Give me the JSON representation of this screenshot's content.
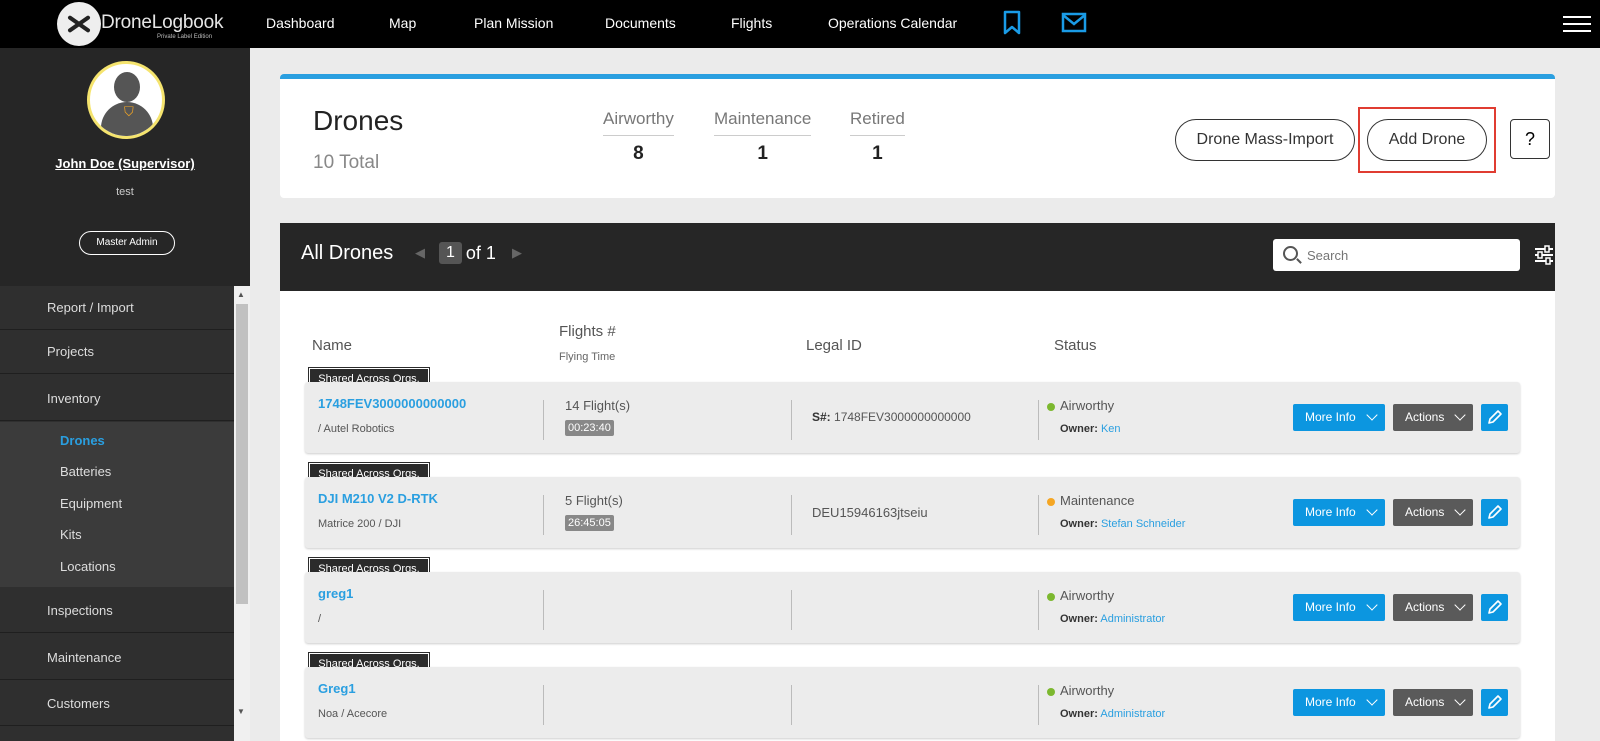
{
  "nav": {
    "logo_text": "DroneLogbook",
    "logo_sub": "Private Label Edition",
    "links": [
      "Dashboard",
      "Map",
      "Plan Mission",
      "Documents",
      "Flights",
      "Operations Calendar"
    ]
  },
  "user": {
    "name": "John Doe (Supervisor)",
    "sub": "test",
    "role": "Master Admin"
  },
  "sidebar": {
    "items": [
      "Report / Import",
      "Projects",
      "Inventory",
      "Inspections",
      "Maintenance",
      "Customers"
    ],
    "inventory_sub": [
      "Drones",
      "Batteries",
      "Equipment",
      "Kits",
      "Locations"
    ]
  },
  "header": {
    "title": "Drones",
    "total": "10 Total",
    "stats": [
      {
        "label": "Airworthy",
        "value": "8"
      },
      {
        "label": "Maintenance",
        "value": "1"
      },
      {
        "label": "Retired",
        "value": "1"
      }
    ],
    "mass_import": "Drone Mass-Import",
    "add_drone": "Add Drone",
    "help": "?"
  },
  "list": {
    "title": "All Drones",
    "page": "1",
    "of": "of 1",
    "search_placeholder": "Search",
    "columns": {
      "name": "Name",
      "flights": "Flights #",
      "flying_time": "Flying Time",
      "legal": "Legal ID",
      "status": "Status"
    },
    "shared_tag": "Shared Across Orgs.",
    "owner_label": "Owner:",
    "more_info": "More Info",
    "actions": "Actions",
    "rows": [
      {
        "name": "1748FEV3000000000000",
        "model": "/ Autel Robotics",
        "flights": "14 Flight(s)",
        "time": "00:23:40",
        "legal_prefix": "S#:",
        "legal": " 1748FEV3000000000000",
        "status": "Airworthy",
        "owner": "Ken"
      },
      {
        "name": "DJI M210 V2 D-RTK",
        "model": "Matrice 200 / DJI",
        "flights": "5 Flight(s)",
        "time": "26:45:05",
        "legal_prefix": "",
        "legal": "DEU15946163jtseiu",
        "status": "Maintenance",
        "owner": "Stefan Schneider"
      },
      {
        "name": "greg1",
        "model": "/",
        "flights": "",
        "time": "",
        "legal_prefix": "",
        "legal": "",
        "status": "Airworthy",
        "owner": "Administrator"
      },
      {
        "name": "Greg1",
        "model": "Noa / Acecore",
        "flights": "",
        "time": "",
        "legal_prefix": "",
        "legal": "",
        "status": "Airworthy",
        "owner": "Administrator"
      }
    ]
  },
  "colors": {
    "accent": "#2a9fe0",
    "airworthy": "#7cb82f",
    "maintenance": "#f5a623",
    "highlight": "#e03c31"
  }
}
